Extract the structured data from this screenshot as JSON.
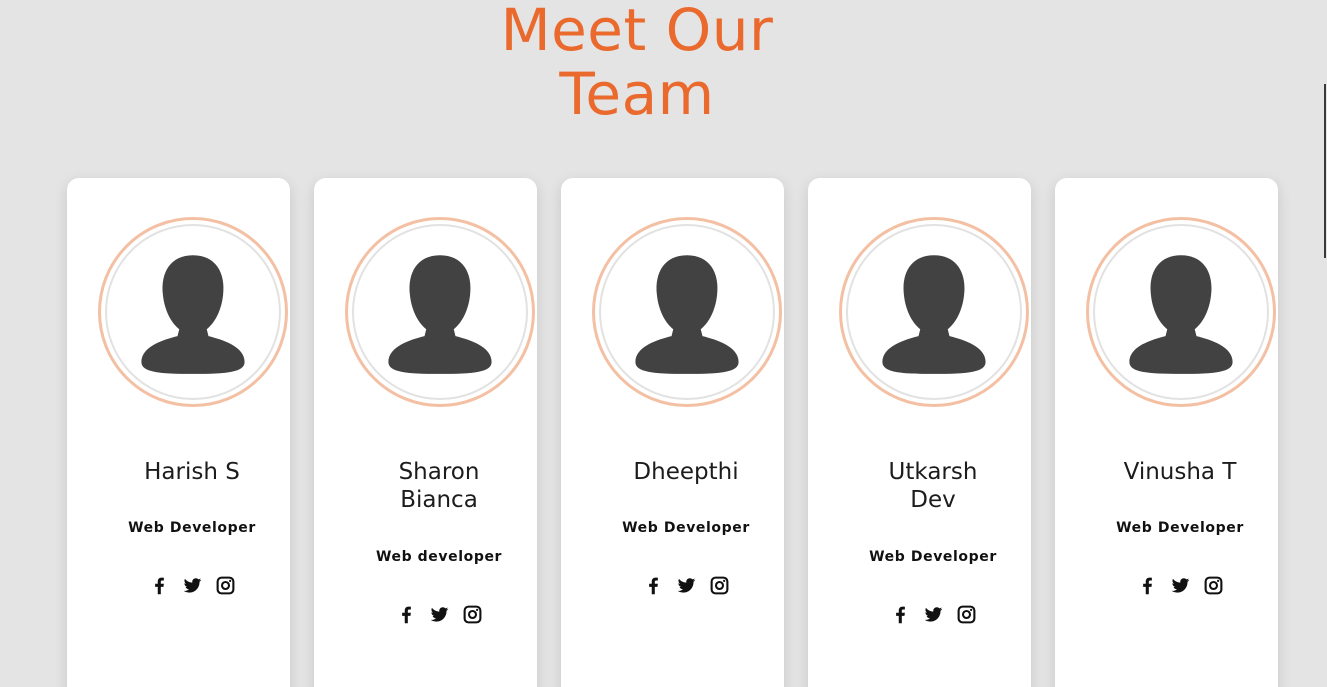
{
  "header": {
    "title_line1": "Meet Our",
    "title_line2": "Team"
  },
  "team": [
    {
      "name_line1": "Harish S",
      "name_line2": "",
      "role": "Web Developer"
    },
    {
      "name_line1": "Sharon",
      "name_line2": "Bianca",
      "role": "Web developer"
    },
    {
      "name_line1": "Dheepthi",
      "name_line2": "",
      "role": "Web Developer"
    },
    {
      "name_line1": "Utkarsh",
      "name_line2": "Dev",
      "role": "Web Developer"
    },
    {
      "name_line1": "Vinusha T",
      "name_line2": "",
      "role": "Web Developer"
    }
  ],
  "icons": {
    "avatar": "person-silhouette-icon",
    "social": [
      "facebook-icon",
      "twitter-icon",
      "instagram-icon"
    ]
  },
  "colors": {
    "accent": "#ea6a2e",
    "avatar_ring": "#f4c0a4",
    "background": "#e4e4e4",
    "card": "#ffffff",
    "silhouette": "#424242"
  }
}
